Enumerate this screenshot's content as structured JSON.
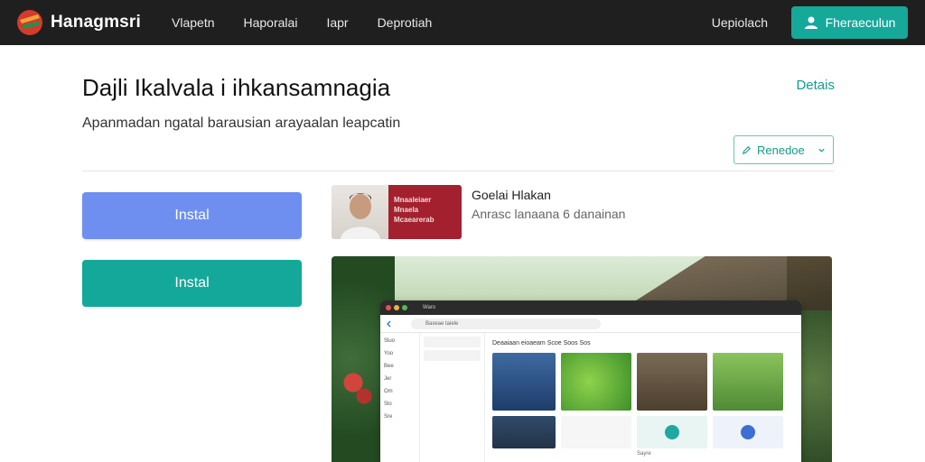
{
  "topbar": {
    "brand": "Hanagmsri",
    "nav": [
      "Vlapetn",
      "Haporalai",
      "Iapr",
      "Deprotiah"
    ],
    "right_link": "Uepiolach",
    "signup_label": "Fheraeculun"
  },
  "header": {
    "title": "Dajli Ikalvala i ihkansamnagia",
    "details_link": "Detais",
    "subtitle": "Apanmadan ngatal barausian arayaalan leapcatin",
    "select_value": "Renedoe"
  },
  "actions": {
    "primary_label": "Instal",
    "secondary_label": "Instal"
  },
  "card": {
    "thumb_text": [
      "Mnaaleiaer",
      "Mnaela",
      "Mcaearerab"
    ],
    "title": "Goelai Hlakan",
    "meta": "Anrasc lanaana 6 danainan"
  },
  "preview_window": {
    "tab": "Waro",
    "url_text": "Baxeae taiele",
    "side_items": [
      "Sluo",
      "Yoo",
      "Bee",
      "Jer",
      "Om",
      "Slo",
      "Sre"
    ],
    "header": "Deaaiaan eioaeam   Scoe   Soos   Sos",
    "tile_caption": "Sayre"
  },
  "colors": {
    "topbar_bg": "#1f1f1f",
    "accent": "#16a899",
    "primary_button": "#6f8ff0",
    "secondary_button": "#14a89b"
  },
  "icons": {
    "brand": "brand-logo-icon",
    "user": "user-icon",
    "select_leading": "pencil-icon",
    "select_trailing": "chevron-down-icon"
  }
}
